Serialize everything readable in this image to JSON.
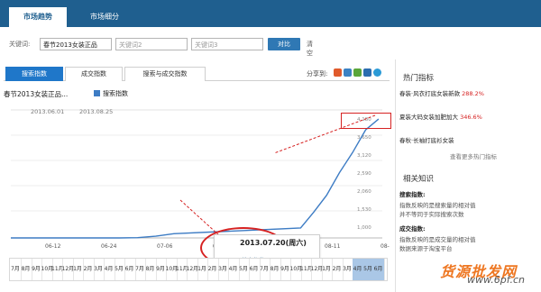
{
  "top_tabs": [
    "市场趋势",
    "市场细分"
  ],
  "search": {
    "label": "关键词:",
    "values": [
      "春节2013女装正品",
      "关键词2",
      "关键词3"
    ],
    "compare_label": "对比",
    "clear_label": "清空"
  },
  "index_tabs": [
    "搜索指数",
    "成交指数",
    "搜索与成交指数"
  ],
  "tools_label": "分享到:",
  "chart": {
    "title": "春节2013女装正品...",
    "legend": "搜索指数",
    "date_range": [
      "2013.06.01",
      "2013.08.25"
    ],
    "x_ticks": [
      "06-12",
      "06-24",
      "07-06",
      "07-18",
      "07-30",
      "08-11",
      "08-23"
    ],
    "y_ticks": [
      "4,180",
      "3,650",
      "3,120",
      "2,590",
      "2,060",
      "1,530",
      "1,000"
    ]
  },
  "chart_data": {
    "type": "line",
    "title": "春节2013女装正品...",
    "series": [
      {
        "name": "搜索指数",
        "x": [
          "06-01",
          "06-08",
          "06-15",
          "06-22",
          "06-29",
          "07-06",
          "07-13",
          "07-20",
          "07-27",
          "08-03",
          "08-10",
          "08-14",
          "08-17",
          "08-19",
          "08-21",
          "08-23",
          "08-25"
        ],
        "values": [
          0,
          0,
          0,
          0,
          0,
          0,
          0,
          10,
          60,
          150,
          350,
          900,
          1500,
          2300,
          3000,
          3800,
          4180
        ]
      }
    ],
    "ylim": [
      0,
      4500
    ]
  },
  "hover": {
    "date": "2013.07.20(周六)",
    "value_label": "搜索指数: 0"
  },
  "date_strip": [
    "7月",
    "8月",
    "9月",
    "10月",
    "11月",
    "12月",
    "1月",
    "2月",
    "3月",
    "4月",
    "5月",
    "6月",
    "7月",
    "8月",
    "9月",
    "10月",
    "11月",
    "12月",
    "1月",
    "2月",
    "3月",
    "4月",
    "5月",
    "6月",
    "7月",
    "8月",
    "9月",
    "10月",
    "11月",
    "12月",
    "1月",
    "2月",
    "3月",
    "4月",
    "5月",
    "6月"
  ],
  "right_panel": {
    "hot_title": "热门指标",
    "hot": [
      {
        "text": "春装·风衣打底女装新款",
        "change": "288.2%"
      },
      {
        "text": "夏装大码女装加肥加大",
        "change": "346.6%"
      },
      {
        "text": "春秋·长袖打底衫女装"
      }
    ],
    "more_label": "查看更多热门指标",
    "know_title": "相关知识",
    "know_sections": [
      {
        "title": "搜索指数:",
        "lines": [
          "指数反映的是搜索量的相对值",
          "并不等同于实际搜索次数"
        ]
      },
      {
        "title": "成交指数:",
        "lines": [
          "指数反映的是成交量的相对值",
          "数据来源于淘宝平台"
        ]
      }
    ]
  },
  "watermark": {
    "title": "货源批发网",
    "url": "www.6pf.cn"
  }
}
